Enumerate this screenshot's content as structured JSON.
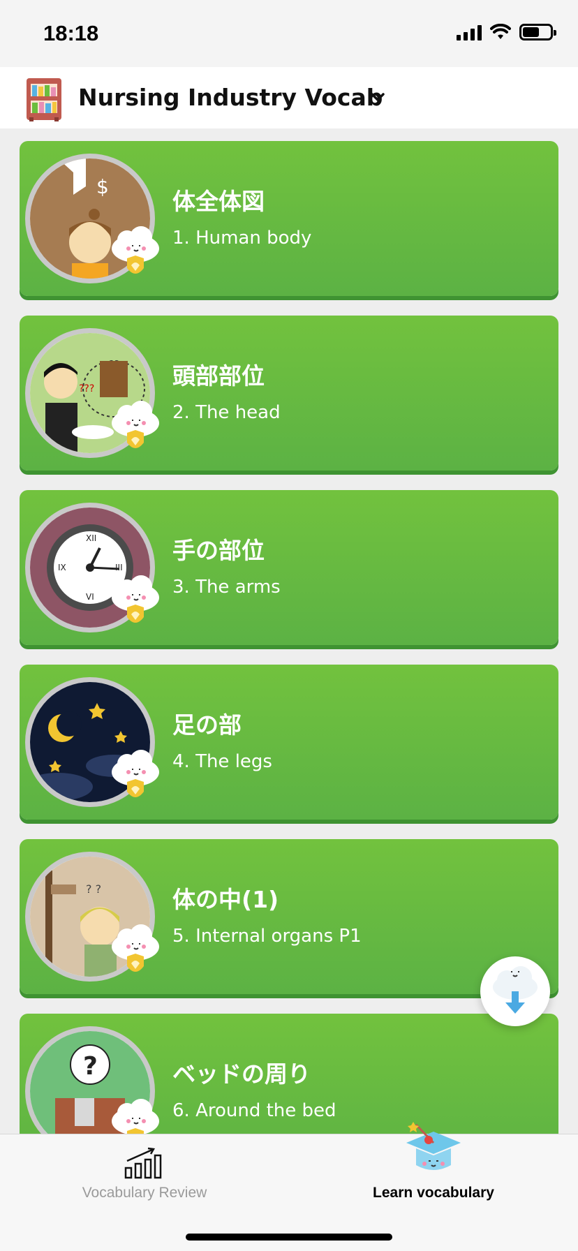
{
  "status_bar": {
    "time": "18:18"
  },
  "header": {
    "title": "Nursing Industry Vocab",
    "book_icon": "bookshelf-icon",
    "dropdown_icon": "chevron-down-icon"
  },
  "lessons": [
    {
      "title": "体全体図",
      "subtitle": "1. Human body"
    },
    {
      "title": "頭部部位",
      "subtitle": "2. The head"
    },
    {
      "title": "手の部位",
      "subtitle": "3. The arms"
    },
    {
      "title": "足の部",
      "subtitle": "4. The legs"
    },
    {
      "title": "体の中(1)",
      "subtitle": "5. Internal organs P1"
    },
    {
      "title": "ベッドの周り",
      "subtitle": "6. Around the bed"
    }
  ],
  "tabs": {
    "review": {
      "label": "Vocabulary Review",
      "icon": "bar-chart-icon"
    },
    "learn": {
      "label": "Learn vocabulary",
      "icon": "graduation-cap-icon"
    }
  },
  "colors": {
    "card_green": "#6cbe3e",
    "card_shadow": "#3f9332",
    "badge_gold": "#f2c531"
  }
}
